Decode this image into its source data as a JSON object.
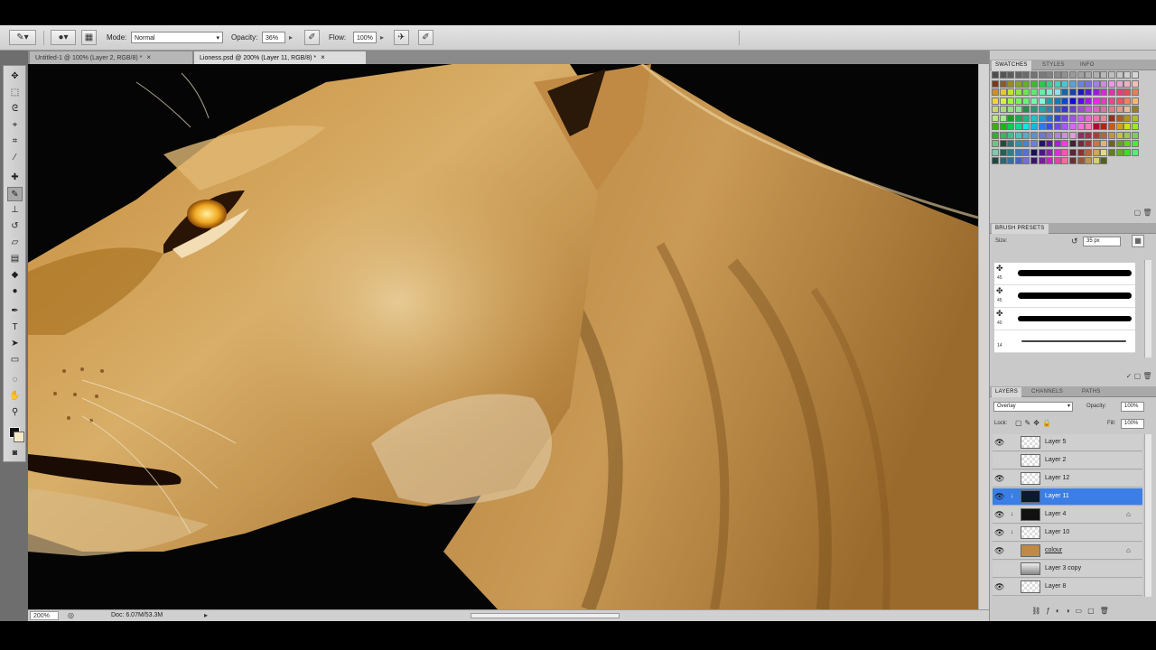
{
  "options_bar": {
    "mode_label": "Mode:",
    "mode_value": "Normal",
    "opacity_label": "Opacity:",
    "opacity_value": "36%",
    "flow_label": "Flow:",
    "flow_value": "100%"
  },
  "document_tabs": [
    {
      "label": "Untitled-1 @ 100% (Layer 2, RGB/8) *",
      "active": false
    },
    {
      "label": "Lioness.psd @ 200% (Layer 11, RGB/8) *",
      "active": true
    }
  ],
  "status_bar": {
    "zoom": "200%",
    "doc_info": "Doc: 6.07M/53.3M"
  },
  "swatches_panel": {
    "tabs": [
      "SWATCHES",
      "STYLES",
      "INFO"
    ]
  },
  "brush_panel": {
    "title": "BRUSH PRESETS",
    "size_label": "Size:",
    "size_value": "35 px",
    "brushes": [
      {
        "size": "45"
      },
      {
        "size": "45"
      },
      {
        "size": "40"
      },
      {
        "size": "14"
      }
    ]
  },
  "layers_panel": {
    "tabs": [
      "LAYERS",
      "CHANNELS",
      "PATHS"
    ],
    "blend_mode": "Overlay",
    "opacity_label": "Opacity:",
    "opacity_value": "100%",
    "lock_label": "Lock:",
    "fill_label": "Fill:",
    "fill_value": "100%",
    "layers": [
      {
        "name": "Layer 5",
        "visible": true,
        "selected": false
      },
      {
        "name": "Layer 2",
        "visible": false,
        "selected": false
      },
      {
        "name": "Layer 12",
        "visible": true,
        "selected": false
      },
      {
        "name": "Layer 11",
        "visible": true,
        "selected": true
      },
      {
        "name": "Layer 4",
        "visible": true,
        "selected": false
      },
      {
        "name": "Layer 10",
        "visible": true,
        "selected": false
      },
      {
        "name": "colour",
        "visible": true,
        "selected": false
      },
      {
        "name": "Layer 3 copy",
        "visible": false,
        "selected": false
      },
      {
        "name": "Layer 8",
        "visible": true,
        "selected": false
      }
    ]
  },
  "colors": {
    "selected_layer": "#3a7ee6",
    "fur_light": "#d6a85a",
    "fur_dark": "#7a4a14",
    "background": "#050505",
    "eye": "#f0a820"
  }
}
